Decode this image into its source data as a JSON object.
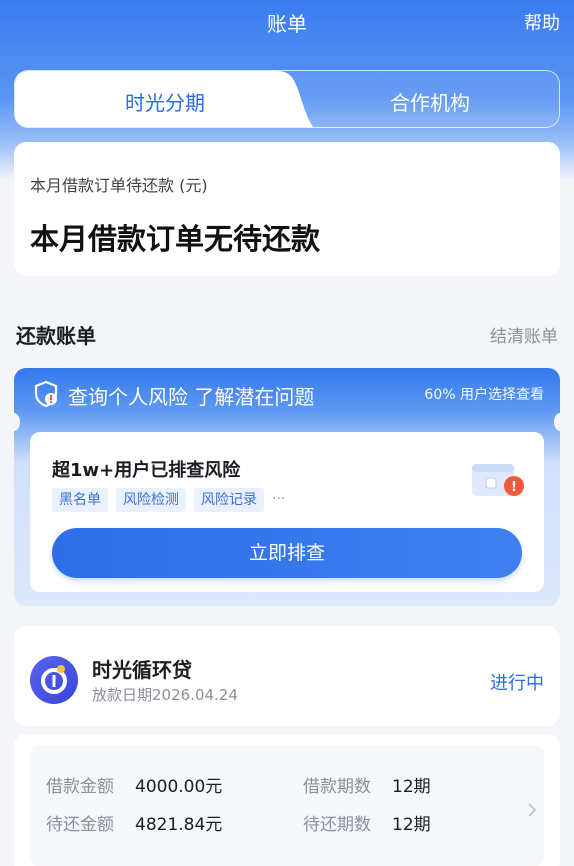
{
  "nav": {
    "title": "账单",
    "help": "帮助"
  },
  "tabs": {
    "active": "时光分期",
    "inactive": "合作机构"
  },
  "due": {
    "label": "本月借款订单待还款 (元)",
    "value": "本月借款订单无待还款"
  },
  "section": {
    "title": "还款账单",
    "link": "结清账单"
  },
  "risk": {
    "header": "查询个人风险 了解潜在问题",
    "note": "60% 用户选择查看",
    "title": "超1w+用户已排查风险",
    "tags": [
      "黑名单",
      "风险检测",
      "风险记录"
    ],
    "more": "···",
    "button": "立即排查",
    "icon": "shield-alert-icon"
  },
  "loan": {
    "name": "时光循环贷",
    "date": "放款日期2026.04.24",
    "status": "进行中",
    "logo_icon": "brand-logo-icon"
  },
  "detail": {
    "loan_amount_label": "借款金额",
    "loan_amount_value": "4000.00元",
    "periods_label": "借款期数",
    "periods_value": "12期",
    "due_amount_label": "待还金额",
    "due_amount_value": "4821.84元",
    "due_periods_label": "待还期数",
    "due_periods_value": "12期"
  },
  "colors": {
    "primary": "#2a6de8",
    "header_gradient_top": "#3a7cf0",
    "background": "#f3f5f9",
    "tag_bg": "#eaf1fd"
  }
}
